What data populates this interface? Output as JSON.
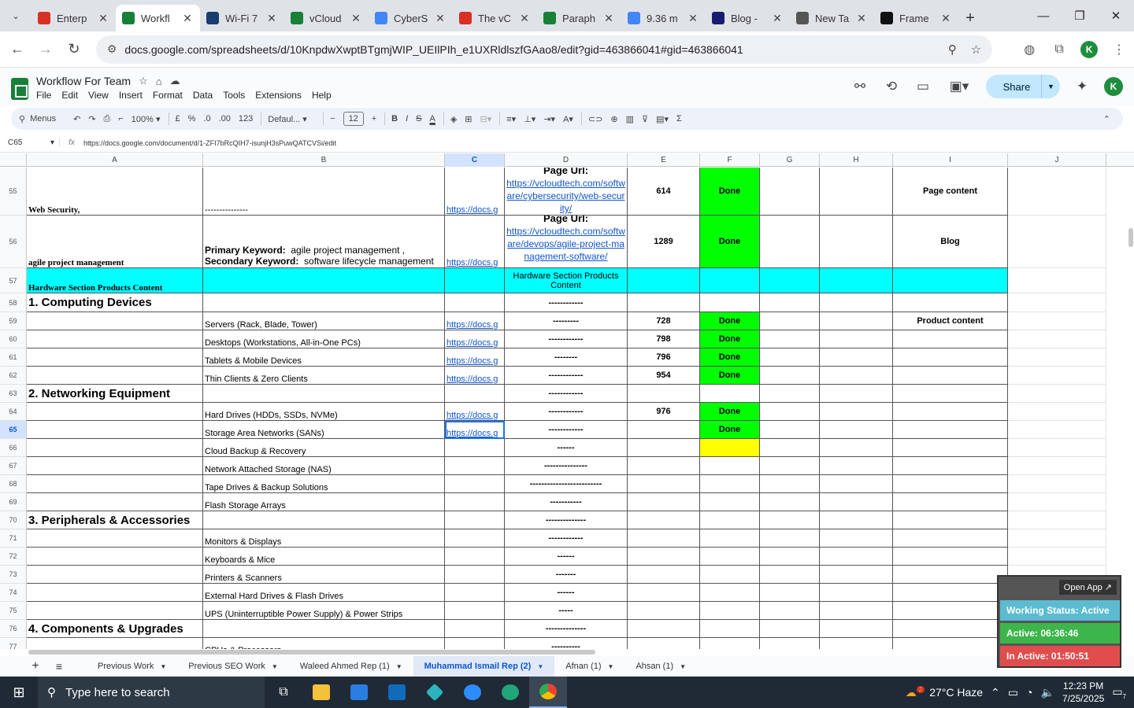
{
  "browser": {
    "tabs": [
      {
        "title": "Enterp",
        "fav_color": "#d93025",
        "active": false
      },
      {
        "title": "Workfl",
        "fav_color": "#188038",
        "active": true
      },
      {
        "title": "Wi-Fi 7",
        "fav_color": "#1a3c6e",
        "active": false
      },
      {
        "title": "vCloud",
        "fav_color": "#188038",
        "active": false
      },
      {
        "title": "CyberS",
        "fav_color": "#4285f4",
        "active": false
      },
      {
        "title": "The vC",
        "fav_color": "#d93025",
        "active": false
      },
      {
        "title": "Paraph",
        "fav_color": "#188038",
        "active": false
      },
      {
        "title": "9.36 m",
        "fav_color": "#4285f4",
        "active": false
      },
      {
        "title": "Blog -",
        "fav_color": "#1a1a6e",
        "active": false
      },
      {
        "title": "New Ta",
        "fav_color": "#555555",
        "active": false
      },
      {
        "title": "Frame",
        "fav_color": "#111111",
        "active": false
      }
    ],
    "url": "docs.google.com/spreadsheets/d/10KnpdwXwptBTgmjWIP_UEIlPIh_e1UXRldlszfGAao8/edit?gid=463866041#gid=463866041",
    "profile_initial": "K"
  },
  "doc": {
    "title": "Workflow For Team",
    "menus": [
      "File",
      "Edit",
      "View",
      "Insert",
      "Format",
      "Data",
      "Tools",
      "Extensions",
      "Help"
    ],
    "share_label": "Share",
    "avatar_initial": "K"
  },
  "toolbar": {
    "search_label": "Menus",
    "zoom": "100%",
    "currency": "£",
    "percent": "%",
    "dec_less": ".0",
    "dec_more": ".00",
    "number_format": "123",
    "font": "Defaul...",
    "font_size": "12"
  },
  "formula_bar": {
    "cell_ref": "C65",
    "formula": "https://docs.google.com/document/d/1-ZFI7bRcQIH7-isunjH3sPuwQATCVSi/edit"
  },
  "columns": [
    "A",
    "B",
    "C",
    "D",
    "E",
    "F",
    "G",
    "H",
    "I",
    "J"
  ],
  "rows": [
    {
      "num": "55",
      "a": "Web Security,",
      "b": "---------------",
      "c": "https://docs.g",
      "d_label": "Page Url:",
      "d_link": "https://vcloudtech.com/software/cybersecurity/web-security/",
      "e": "614",
      "f": "Done",
      "i": "Page content"
    },
    {
      "num": "56",
      "a": "agile project management",
      "b1_label": "Primary Keyword:",
      "b1_val": "agile project management ,",
      "b2_label": "Secondary Keyword:",
      "b2_val": "software lifecycle management",
      "c": "https://docs.g",
      "d_label": "Page Url:",
      "d_link": "https://vcloudtech.com/software/devops/agile-project-management-software/",
      "e": "1289",
      "f": "Done",
      "i": "Blog"
    },
    {
      "num": "57",
      "a": "Hardware Section Products Content",
      "d": "Hardware Section Products Content"
    },
    {
      "num": "58",
      "a": "1. Computing Devices",
      "d": "------------"
    },
    {
      "num": "59",
      "b": "Servers (Rack, Blade, Tower)",
      "c": "https://docs.g",
      "d": "---------",
      "e": "728",
      "f": "Done",
      "i": "Product content"
    },
    {
      "num": "60",
      "b": "Desktops (Workstations, All-in-One PCs)",
      "c": "https://docs.g",
      "d": "------------",
      "e": "798",
      "f": "Done"
    },
    {
      "num": "61",
      "b": "Tablets & Mobile Devices",
      "c": "https://docs.g",
      "d": "--------",
      "e": "796",
      "f": "Done"
    },
    {
      "num": "62",
      "b": "Thin Clients & Zero Clients",
      "c": "https://docs.g",
      "d": "------------",
      "e": "954",
      "f": "Done"
    },
    {
      "num": "63",
      "a": "2. Networking Equipment",
      "d": "------------"
    },
    {
      "num": "64",
      "b": "Hard Drives (HDDs, SSDs, NVMe)",
      "c": "https://docs.g",
      "d": "------------",
      "e": "976",
      "f": "Done"
    },
    {
      "num": "65",
      "b": "Storage Area Networks (SANs)",
      "c": "https://docs.g",
      "d": "------------",
      "f": "Done"
    },
    {
      "num": "66",
      "b": "Cloud Backup & Recovery",
      "d": "------"
    },
    {
      "num": "67",
      "b": "Network Attached Storage (NAS)",
      "d": "---------------"
    },
    {
      "num": "68",
      "b": "Tape Drives & Backup Solutions",
      "d": "-------------------------"
    },
    {
      "num": "69",
      "b": "Flash Storage Arrays",
      "d": "-----------"
    },
    {
      "num": "70",
      "a": "3. Peripherals & Accessories",
      "d": "--------------"
    },
    {
      "num": "71",
      "b": "Monitors & Displays",
      "d": "------------"
    },
    {
      "num": "72",
      "b": "Keyboards & Mice",
      "d": "------"
    },
    {
      "num": "73",
      "b": "Printers & Scanners",
      "d": "-------"
    },
    {
      "num": "74",
      "b": "External Hard Drives & Flash Drives",
      "d": "------"
    },
    {
      "num": "75",
      "b": "UPS (Uninterruptible Power Supply) & Power Strips",
      "d": "-----"
    },
    {
      "num": "76",
      "a": "4. Components & Upgrades",
      "d": "--------------"
    },
    {
      "num": "77",
      "b": "CPUs & Processors",
      "d": "----------"
    }
  ],
  "sheet_tabs": [
    {
      "label": "Previous Work",
      "active": false
    },
    {
      "label": "Previous SEO Work",
      "active": false
    },
    {
      "label": "Waleed Ahmed Rep (1)",
      "active": false
    },
    {
      "label": "Muhammad Ismail Rep (2)",
      "active": true
    },
    {
      "label": "Afnan (1)",
      "active": false
    },
    {
      "label": "Ahsan (1)",
      "active": false
    }
  ],
  "widget": {
    "open_app": "Open App ↗",
    "status": "Working Status: Active",
    "active": "Active: 06:36:46",
    "inactive": "In Active: 01:50:51"
  },
  "taskbar": {
    "search_placeholder": "Type here to search",
    "weather": "27°C  Haze",
    "weather_badge": "2",
    "time": "12:23 PM",
    "date": "7/25/2025",
    "notif_count": "7"
  },
  "colors": {
    "done_green": "#00ff00",
    "section_cyan": "#00ffff",
    "pending_yellow": "#ffff00",
    "link_blue": "#1155cc"
  }
}
